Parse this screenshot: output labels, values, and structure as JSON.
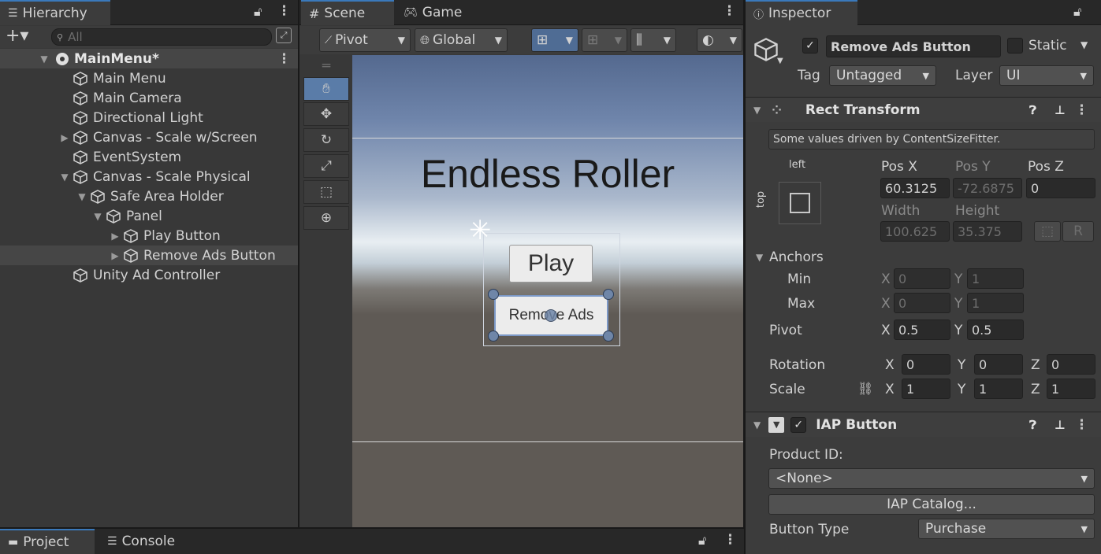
{
  "hierarchy": {
    "tab_label": "Hierarchy",
    "search_placeholder": "All",
    "items": [
      {
        "label": "MainMenu*"
      },
      {
        "label": "Main Menu"
      },
      {
        "label": "Main Camera"
      },
      {
        "label": "Directional Light"
      },
      {
        "label": "Canvas - Scale w/Screen"
      },
      {
        "label": "EventSystem"
      },
      {
        "label": "Canvas - Scale Physical"
      },
      {
        "label": "Safe Area Holder"
      },
      {
        "label": "Panel"
      },
      {
        "label": "Play Button"
      },
      {
        "label": "Remove Ads Button"
      },
      {
        "label": "Unity Ad Controller"
      }
    ]
  },
  "scene": {
    "tabs": [
      {
        "label": "Scene"
      },
      {
        "label": "Game"
      }
    ],
    "toolbar": {
      "pivot": "Pivot",
      "global": "Global"
    },
    "game_title": "Endless Roller",
    "play_label": "Play",
    "remove_ads_label": "Remove Ads"
  },
  "inspector": {
    "tab_label": "Inspector",
    "object_name": "Remove Ads Button",
    "static_label": "Static",
    "tag_label": "Tag",
    "tag_value": "Untagged",
    "layer_label": "Layer",
    "layer_value": "UI",
    "rect_transform": {
      "title": "Rect Transform",
      "notice": "Some values driven by ContentSizeFitter.",
      "anchor_h": "left",
      "anchor_v": "top",
      "pos_x_label": "Pos X",
      "pos_y_label": "Pos Y",
      "pos_z_label": "Pos Z",
      "pos_x": "60.3125",
      "pos_y": "-72.6875",
      "pos_z": "0",
      "width_label": "Width",
      "height_label": "Height",
      "width": "100.625",
      "height": "35.375",
      "r_button": "R",
      "anchors_label": "Anchors",
      "min_label": "Min",
      "max_label": "Max",
      "min_x": "0",
      "min_y": "1",
      "max_x": "0",
      "max_y": "1",
      "pivot_label": "Pivot",
      "pivot_x": "0.5",
      "pivot_y": "0.5",
      "rotation_label": "Rotation",
      "rot_x": "0",
      "rot_y": "0",
      "rot_z": "0",
      "scale_label": "Scale",
      "scale_x": "1",
      "scale_y": "1",
      "scale_z": "1",
      "x": "X",
      "y": "Y",
      "z": "Z"
    },
    "iap_button": {
      "title": "IAP Button",
      "product_id_label": "Product ID:",
      "product_id_value": "<None>",
      "catalog_button": "IAP Catalog...",
      "button_type_label": "Button Type",
      "button_type_value": "Purchase"
    }
  },
  "bottom_tabs": [
    {
      "label": "Project"
    },
    {
      "label": "Console"
    }
  ]
}
